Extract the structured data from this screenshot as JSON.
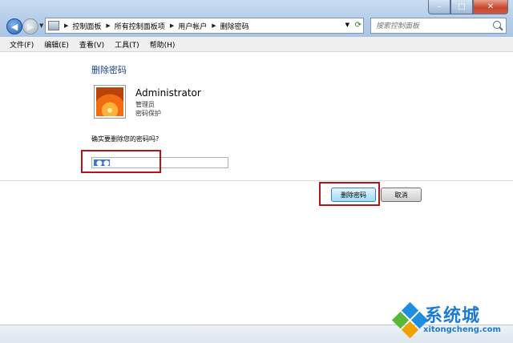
{
  "window": {
    "minimize_icon": "minimize-icon",
    "maximize_icon": "maximize-icon",
    "close_icon": "close-icon"
  },
  "nav": {
    "back_icon": "back-arrow-icon",
    "forward_icon": "forward-arrow-icon"
  },
  "address": {
    "crumbs": [
      "控制面板",
      "所有控制面板项",
      "用户帐户",
      "删除密码"
    ]
  },
  "search": {
    "placeholder": "搜索控制面板"
  },
  "menu": {
    "items": [
      "文件(F)",
      "编辑(E)",
      "查看(V)",
      "工具(T)",
      "帮助(H)"
    ]
  },
  "main": {
    "heading": "删除密码",
    "user_name": "Administrator",
    "user_role": "管理员",
    "user_protection": "密码保护",
    "question": "确实要删除您的密码吗?",
    "password_dots": "●●●"
  },
  "buttons": {
    "delete_label": "删除密码",
    "cancel_label": "取消"
  },
  "watermark": {
    "brand": "系统城",
    "url": "xitongcheng.com"
  },
  "colors": {
    "highlight_box": "#b3141a",
    "heading": "#1d3f8a",
    "brand": "#1a7ad6"
  }
}
